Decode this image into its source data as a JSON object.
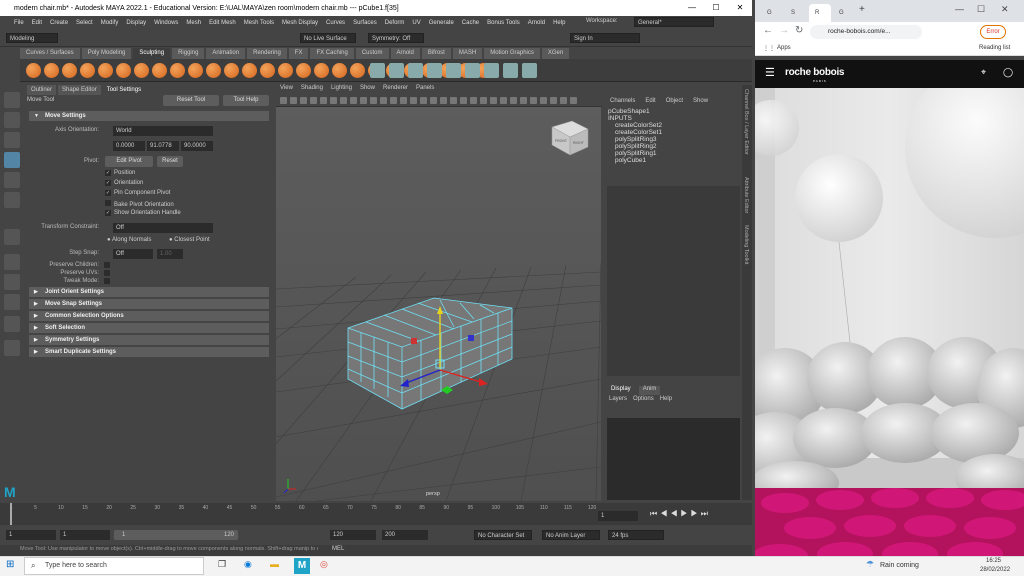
{
  "maya": {
    "title": "modern chair.mb* - Autodesk MAYA 2022.1 - Educational Version: E:\\UAL\\MAYA\\zen room\\modern chair.mb  ---  pCube1.f[35]",
    "menu": [
      "File",
      "Edit",
      "Create",
      "Select",
      "Modify",
      "Display",
      "Windows",
      "Mesh",
      "Edit Mesh",
      "Mesh Tools",
      "Mesh Display",
      "Curves",
      "Surfaces",
      "Deform",
      "UV",
      "Generate",
      "Cache",
      "Bonus Tools",
      "Arnold",
      "Help"
    ],
    "workspace_label": "Workspace:",
    "workspace_value": "General*",
    "mode": "Modeling",
    "live_surface": "No Live Surface",
    "symmetry": "Symmetry: Off",
    "signin": "Sign In",
    "shelf_tabs": [
      "Curves / Surfaces",
      "Poly Modeling",
      "Sculpting",
      "Rigging",
      "Animation",
      "Rendering",
      "FX",
      "FX Caching",
      "Custom",
      "Arnold",
      "Bifrost",
      "MASH",
      "Motion Graphics",
      "XGen"
    ],
    "active_shelf": "Sculpting",
    "ae_tabs": [
      "Outliner",
      "Shape Editor",
      "Tool Settings"
    ],
    "tool_name": "Move Tool",
    "reset_tool": "Reset Tool",
    "tool_help": "Tool Help",
    "move_settings": "Move Settings",
    "axis_orientation_label": "Axis Orientation:",
    "axis_orientation": "World",
    "xyz": [
      "0.0000",
      "91.0778",
      "90.0000"
    ],
    "pivot_label": "Pivot:",
    "edit_pivot": "Edit Pivot",
    "reset": "Reset",
    "pivot_checks": [
      {
        "label": "Position",
        "on": true
      },
      {
        "label": "Orientation",
        "on": true
      },
      {
        "label": "Pin Component Pivot",
        "on": true
      },
      {
        "label": "Bake Pivot Orientation",
        "on": false
      },
      {
        "label": "Show Orientation Handle",
        "on": true
      }
    ],
    "transform_constraint_label": "Transform Constraint:",
    "transform_constraint": "Off",
    "along_normals": "Along Normals",
    "closest_point": "Closest Point",
    "step_snap_label": "Step Snap:",
    "step_snap": "Off",
    "step_value": "1.00",
    "preserve_children": "Preserve Children:",
    "preserve_uvs": "Preserve UVs:",
    "tweak_mode": "Tweak Mode:",
    "sections": [
      "Joint Orient Settings",
      "Move Snap Settings",
      "Common Selection Options",
      "Soft Selection",
      "Symmetry Settings",
      "Smart Duplicate Settings"
    ],
    "vp_menu": [
      "View",
      "Shading",
      "Lighting",
      "Show",
      "Renderer",
      "Panels"
    ],
    "vp_camera": "persp",
    "cube_faces": [
      "FRONT",
      "RIGHT"
    ],
    "cb_menu": [
      "Channels",
      "Edit",
      "Object",
      "Show"
    ],
    "cb_items": [
      "pCubeShape1",
      "INPUTS",
      "createColorSet2",
      "createColorSet1",
      "polySplitRing3",
      "polySplitRing2",
      "polySplitRing1",
      "polyCube1"
    ],
    "layer_tabs": [
      "Display",
      "Anim"
    ],
    "layer_menu": [
      "Layers",
      "Options",
      "Help"
    ],
    "side_tabs": [
      "Channel Box / Layer Editor",
      "Attribute Editor",
      "Modeling Toolkit"
    ],
    "time_ticks": [
      "1",
      "5",
      "10",
      "15",
      "20",
      "25",
      "30",
      "35",
      "40",
      "45",
      "50",
      "55",
      "60",
      "65",
      "70",
      "75",
      "80",
      "85",
      "90",
      "95",
      "100",
      "105",
      "110",
      "115",
      "120"
    ],
    "current_frame": "1",
    "range": {
      "start": "1",
      "inner_start": "1",
      "inner_start2": "1",
      "inner_end": "120",
      "end": "120",
      "total": "200"
    },
    "char_set": "No Character Set",
    "anim_layer": "No Anim Layer",
    "fps": "24 fps",
    "help_line": "Move Tool: Use manipulator to move object(s). Ctrl+middle-drag to move components along normals. Shift+drag manip to extrude components.",
    "mel": "MEL"
  },
  "browser": {
    "tabs": [
      "G",
      "S",
      "R",
      "G"
    ],
    "active_tab": "R",
    "address": "roche-bobois.com/e...",
    "error_label": "Error",
    "apps": "Apps",
    "reading_list": "Reading list",
    "brand": "roche bobois",
    "brand_sub": "PARIS"
  },
  "taskbar": {
    "search": "Type here to search",
    "weather": "Rain coming",
    "time": "16:25",
    "date": "28/02/2022"
  }
}
